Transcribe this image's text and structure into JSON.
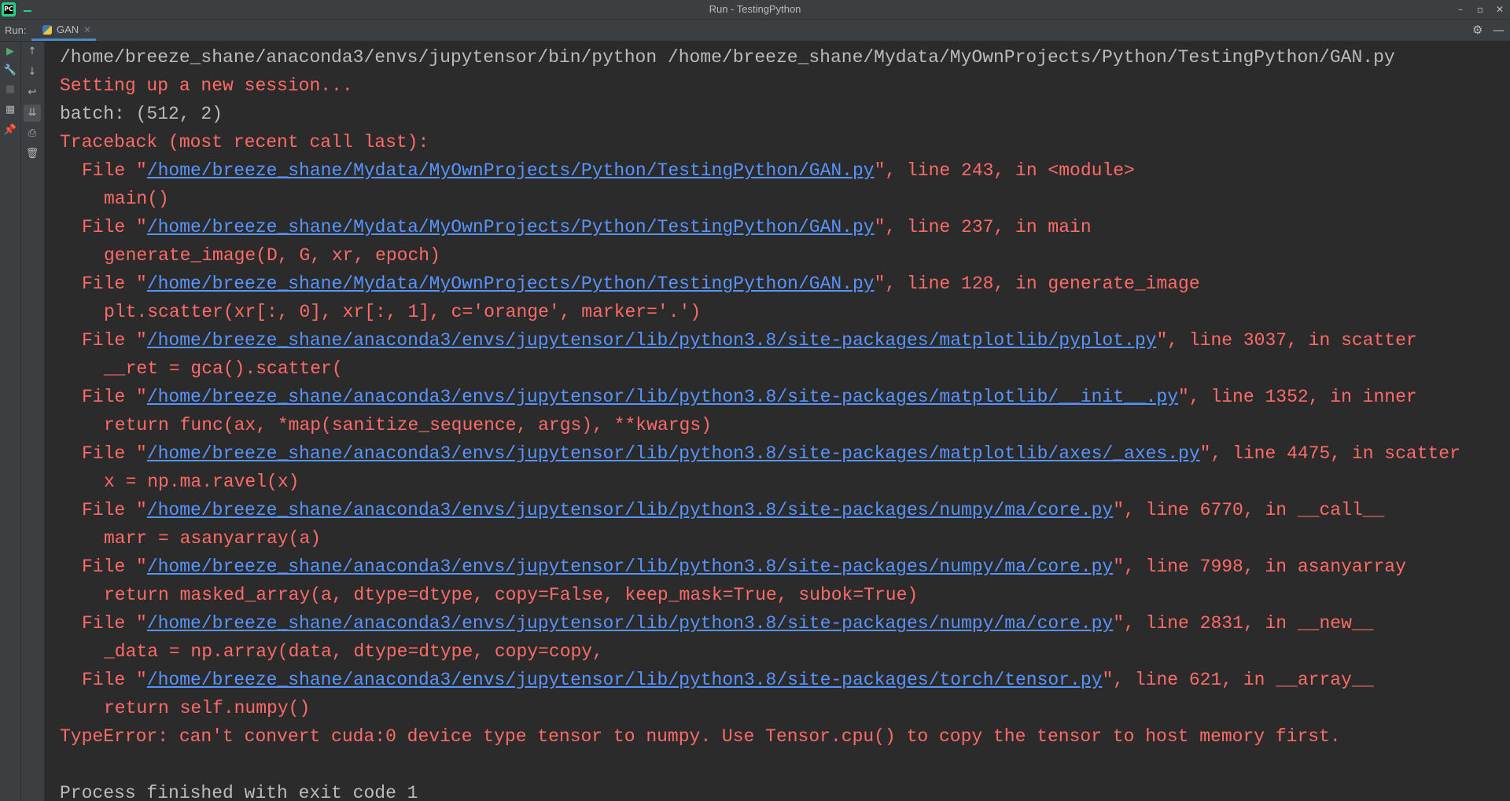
{
  "window": {
    "title": "Run - TestingPython"
  },
  "runbar": {
    "label": "Run:",
    "tab_label": "GAN"
  },
  "icons": {
    "rerun": "play-icon",
    "settings": "gear-icon",
    "hide": "minimize-icon"
  },
  "console": {
    "command": "/home/breeze_shane/anaconda3/envs/jupytensor/bin/python /home/breeze_shane/Mydata/MyOwnProjects/Python/TestingPython/GAN.py",
    "session_msg": "Setting up a new session...",
    "batch_msg": "batch: (512, 2)",
    "traceback_header": "Traceback (most recent call last):",
    "frames": [
      {
        "path": "/home/breeze_shane/Mydata/MyOwnProjects/Python/TestingPython/GAN.py",
        "suffix": "\", line 243, in <module>",
        "code": "main()"
      },
      {
        "path": "/home/breeze_shane/Mydata/MyOwnProjects/Python/TestingPython/GAN.py",
        "suffix": "\", line 237, in main",
        "code": "generate_image(D, G, xr, epoch)"
      },
      {
        "path": "/home/breeze_shane/Mydata/MyOwnProjects/Python/TestingPython/GAN.py",
        "suffix": "\", line 128, in generate_image",
        "code": "plt.scatter(xr[:, 0], xr[:, 1], c='orange', marker='.')"
      },
      {
        "path": "/home/breeze_shane/anaconda3/envs/jupytensor/lib/python3.8/site-packages/matplotlib/pyplot.py",
        "suffix": "\", line 3037, in scatter",
        "code": "__ret = gca().scatter("
      },
      {
        "path": "/home/breeze_shane/anaconda3/envs/jupytensor/lib/python3.8/site-packages/matplotlib/__init__.py",
        "suffix": "\", line 1352, in inner",
        "code": "return func(ax, *map(sanitize_sequence, args), **kwargs)"
      },
      {
        "path": "/home/breeze_shane/anaconda3/envs/jupytensor/lib/python3.8/site-packages/matplotlib/axes/_axes.py",
        "suffix": "\", line 4475, in scatter",
        "code": "x = np.ma.ravel(x)"
      },
      {
        "path": "/home/breeze_shane/anaconda3/envs/jupytensor/lib/python3.8/site-packages/numpy/ma/core.py",
        "suffix": "\", line 6770, in __call__",
        "code": "marr = asanyarray(a)"
      },
      {
        "path": "/home/breeze_shane/anaconda3/envs/jupytensor/lib/python3.8/site-packages/numpy/ma/core.py",
        "suffix": "\", line 7998, in asanyarray",
        "code": "return masked_array(a, dtype=dtype, copy=False, keep_mask=True, subok=True)"
      },
      {
        "path": "/home/breeze_shane/anaconda3/envs/jupytensor/lib/python3.8/site-packages/numpy/ma/core.py",
        "suffix": "\", line 2831, in __new__",
        "code": "_data = np.array(data, dtype=dtype, copy=copy,"
      },
      {
        "path": "/home/breeze_shane/anaconda3/envs/jupytensor/lib/python3.8/site-packages/torch/tensor.py",
        "suffix": "\", line 621, in __array__",
        "code": "return self.numpy()"
      }
    ],
    "file_prefix": "File \"",
    "error": "TypeError: can't convert cuda:0 device type tensor to numpy. Use Tensor.cpu() to copy the tensor to host memory first.",
    "exit_msg": "Process finished with exit code 1"
  }
}
